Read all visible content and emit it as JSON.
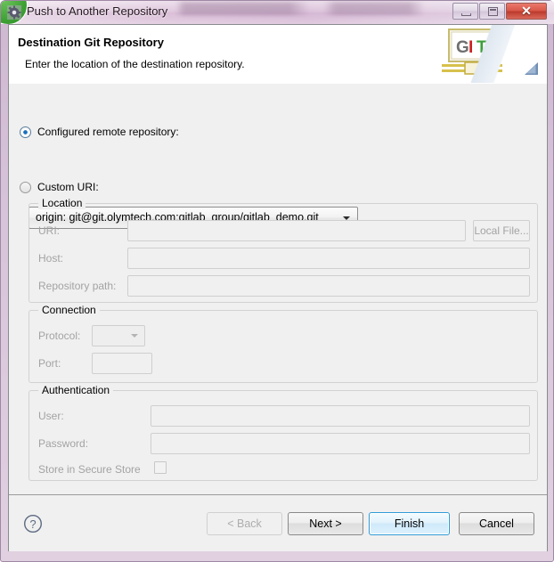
{
  "window": {
    "title": "Push to Another Repository",
    "icon": "gear-icon",
    "controls": {
      "minimize": "minimize-icon",
      "maximize": "maximize-icon",
      "close": "✕"
    }
  },
  "header": {
    "title": "Destination Git Repository",
    "description": "Enter the location of the destination repository.",
    "banner_logo": {
      "letters": [
        {
          "char": "G",
          "color": "#6f6f6f"
        },
        {
          "char": "I",
          "color": "#cc2222"
        },
        {
          "char": "T",
          "color": "#3c9e3c"
        }
      ],
      "band_color": "#d7c14b"
    }
  },
  "main": {
    "source_options": [
      {
        "label": "Configured remote repository:",
        "selected": true
      },
      {
        "label": "Custom URI:",
        "selected": false
      }
    ],
    "remote_combo": {
      "value": "origin: git@git.olymtech.com:gitlab_group/gitlab_demo.git",
      "enabled": true
    },
    "groups": [
      {
        "title": "Location",
        "fields": [
          {
            "label": "URI:",
            "value": "",
            "enabled": false
          },
          {
            "label": "Host:",
            "value": "",
            "enabled": false
          },
          {
            "label": "Repository path:",
            "value": "",
            "enabled": false
          }
        ],
        "button": {
          "label": "Local File...",
          "enabled": false
        }
      },
      {
        "title": "Connection",
        "fields": [
          {
            "label": "Protocol:",
            "value": "",
            "enabled": false
          },
          {
            "label": "Port:",
            "value": "",
            "enabled": false
          }
        ]
      },
      {
        "title": "Authentication",
        "fields": [
          {
            "label": "User:",
            "value": "",
            "enabled": false
          },
          {
            "label": "Password:",
            "value": "",
            "enabled": false
          }
        ],
        "checkbox": {
          "label": "Store in Secure Store",
          "checked": false,
          "enabled": false
        }
      }
    ]
  },
  "footer": {
    "help": "?",
    "buttons": [
      {
        "label": "< Back",
        "enabled": false,
        "default": false
      },
      {
        "label": "Next >",
        "enabled": true,
        "default": false
      },
      {
        "label": "Finish",
        "enabled": true,
        "default": true
      },
      {
        "label": "Cancel",
        "enabled": true,
        "default": false
      }
    ]
  },
  "colors": {
    "accent": "#2f9bd8",
    "radio_selected": "#1c6fbd",
    "window_frame": "#cdb8d0",
    "close_button": "#d9584a",
    "dialog_bg": "#f0f0f0",
    "disabled_text": "#a3a3a3"
  }
}
